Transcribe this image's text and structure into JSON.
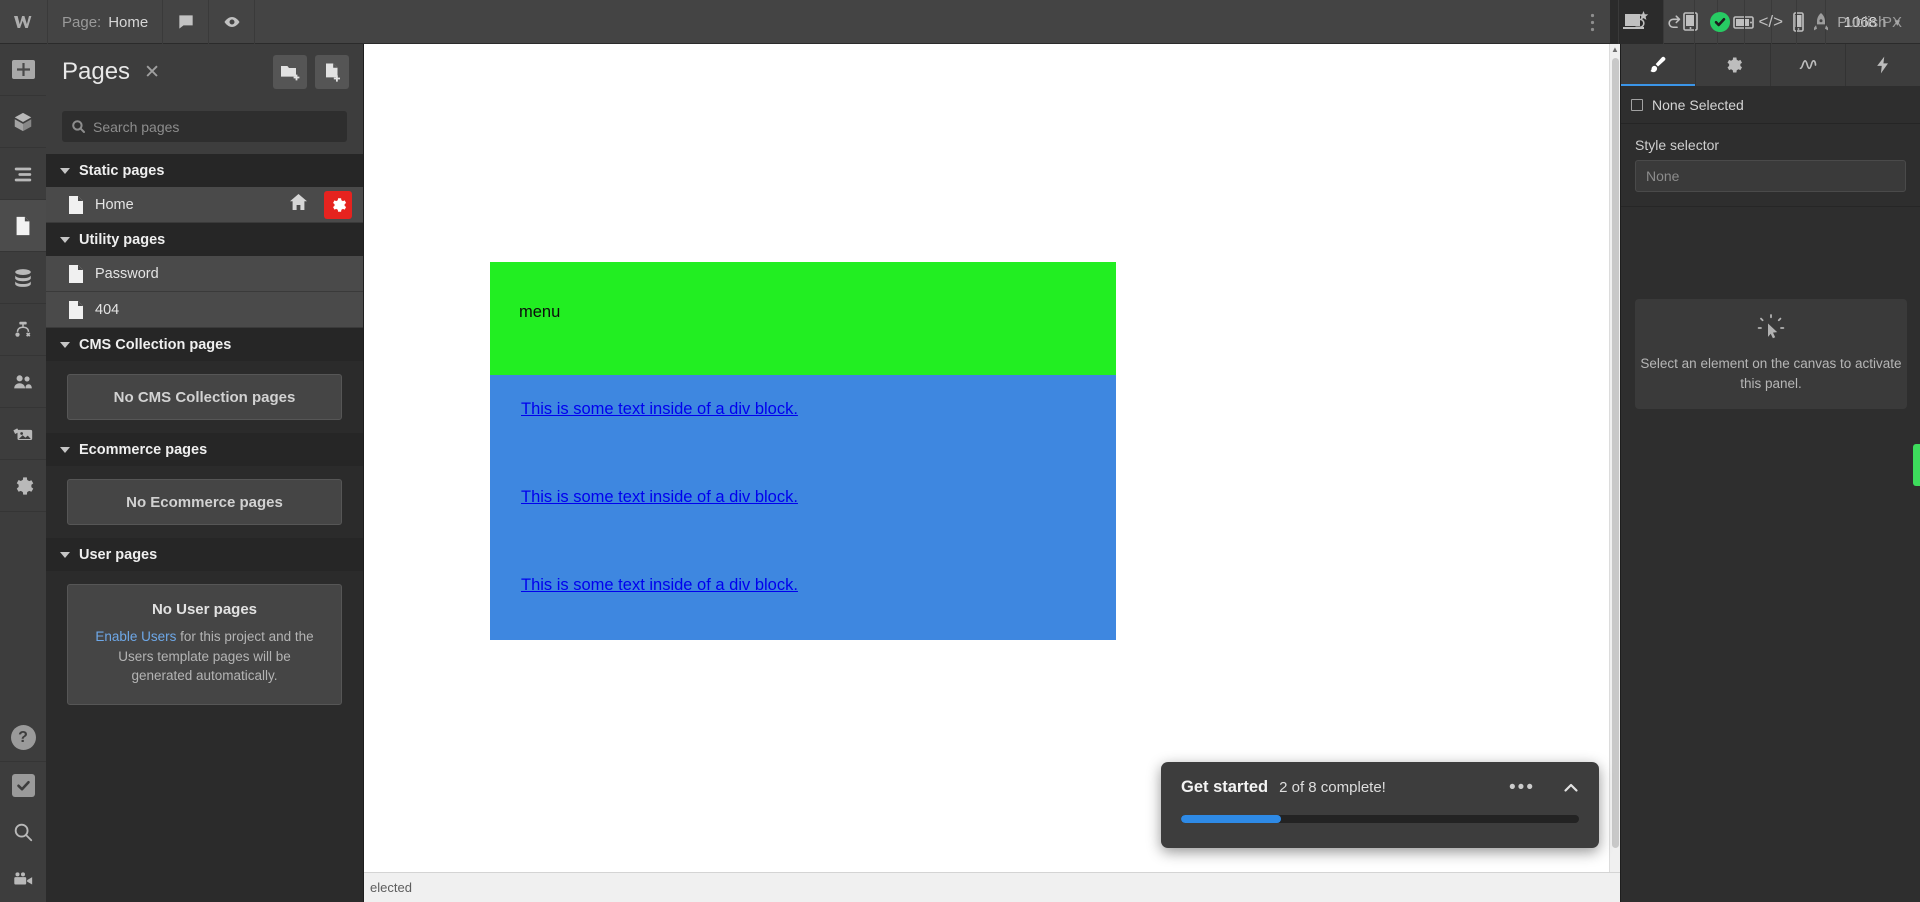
{
  "topbar": {
    "logo_icon": "webflow-logo-icon",
    "page_label": "Page:",
    "page_name": "Home",
    "comment_icon": "comment-icon",
    "preview_icon": "eye-preview-icon",
    "more_icon": "more-vertical-icon",
    "breakpoints": [
      {
        "name": "breakpoint-desktop",
        "icon": "desktop-star-icon",
        "active": true
      },
      {
        "name": "breakpoint-tablet",
        "icon": "tablet-icon",
        "active": false
      },
      {
        "name": "breakpoint-tablet-landscape",
        "icon": "tablet-landscape-icon",
        "active": false
      },
      {
        "name": "breakpoint-mobile",
        "icon": "mobile-icon",
        "active": false
      }
    ],
    "viewport_size": "1068",
    "viewport_unit": "PX",
    "undo_icon": "undo-icon",
    "redo_icon": "redo-icon",
    "save_status_icon": "check-circle-icon",
    "code_label": "</>",
    "publish_icon": "rocket-icon",
    "publish_label": "Publish",
    "publish_chevron": "▾"
  },
  "rail": {
    "items": [
      {
        "name": "rail-add",
        "icon": "plus-icon",
        "active": false
      },
      {
        "name": "rail-components",
        "icon": "components-box-icon",
        "active": false
      },
      {
        "name": "rail-navigator",
        "icon": "navigator-layers-icon",
        "active": false
      },
      {
        "name": "rail-pages",
        "icon": "pages-file-icon",
        "active": true
      },
      {
        "name": "rail-cms",
        "icon": "database-icon",
        "active": false
      },
      {
        "name": "rail-logic",
        "icon": "logic-flow-icon",
        "active": false
      },
      {
        "name": "rail-users",
        "icon": "users-people-icon",
        "active": false
      },
      {
        "name": "rail-assets",
        "icon": "assets-images-icon",
        "active": false
      },
      {
        "name": "rail-settings",
        "icon": "gear-icon",
        "active": false
      }
    ],
    "bottom": [
      {
        "name": "rail-help",
        "icon": "question-mark-icon"
      },
      {
        "name": "rail-audit",
        "icon": "checkbox-check-icon"
      },
      {
        "name": "rail-search",
        "icon": "search-icon"
      },
      {
        "name": "rail-video",
        "icon": "video-camera-icon"
      }
    ]
  },
  "pages_panel": {
    "title": "Pages",
    "close_icon": "close-icon",
    "new_folder_icon": "new-folder-icon",
    "new_page_icon": "new-page-icon",
    "search_placeholder": "Search pages",
    "search_icon": "search-icon",
    "groups": [
      {
        "name": "static-pages",
        "label": "Static pages",
        "pages": [
          {
            "label": "Home",
            "is_home": true,
            "settings_highlighted": true
          }
        ]
      },
      {
        "name": "utility-pages",
        "label": "Utility pages",
        "pages": [
          {
            "label": "Password",
            "is_home": false,
            "settings_highlighted": false
          },
          {
            "label": "404",
            "is_home": false,
            "settings_highlighted": false
          }
        ]
      },
      {
        "name": "cms-collection-pages",
        "label": "CMS Collection pages",
        "empty_label": "No CMS Collection pages"
      },
      {
        "name": "ecommerce-pages",
        "label": "Ecommerce pages",
        "empty_label": "No Ecommerce pages"
      },
      {
        "name": "user-pages",
        "label": "User pages",
        "empty_title": "No User pages",
        "empty_link": "Enable Users",
        "empty_text": " for this project and the Users template pages will be generated automatically."
      }
    ]
  },
  "canvas": {
    "menu_text": "menu",
    "menu_bg": "#22ee22",
    "blue_bg": "#3e87e0",
    "links": [
      "This is some text inside of a div block.",
      "This is some text inside of a div block.",
      "This is some text inside of a div block."
    ],
    "link_color": "#0000ee"
  },
  "statusbar": {
    "text": "elected"
  },
  "get_started": {
    "title": "Get started",
    "subtitle": "2 of 8 complete!",
    "more_icon": "more-horizontal-icon",
    "collapse_icon": "chevron-up-icon",
    "progress_percent": 25,
    "progress_color": "#2e8ae6"
  },
  "right_panel": {
    "tabs": [
      {
        "name": "tab-style",
        "icon": "paintbrush-icon",
        "active": true
      },
      {
        "name": "tab-settings",
        "icon": "gear-icon",
        "active": false
      },
      {
        "name": "tab-interactions",
        "icon": "interactions-icon",
        "active": false
      },
      {
        "name": "tab-effects",
        "icon": "lightning-bolt-icon",
        "active": false
      }
    ],
    "selection_label": "None Selected",
    "selection_icon": "square-outline-icon",
    "style_selector_label": "Style selector",
    "style_selector_value": "None",
    "empty_icon": "click-cursor-icon",
    "empty_text": "Select an element on the canvas to activate this panel."
  }
}
